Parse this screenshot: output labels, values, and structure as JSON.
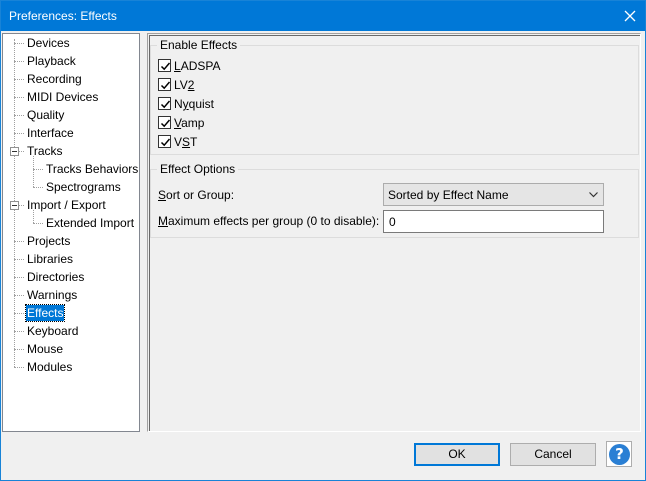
{
  "window": {
    "title": "Preferences: Effects"
  },
  "tree": {
    "items": [
      {
        "label": "Devices",
        "level": 0
      },
      {
        "label": "Playback",
        "level": 0
      },
      {
        "label": "Recording",
        "level": 0
      },
      {
        "label": "MIDI Devices",
        "level": 0
      },
      {
        "label": "Quality",
        "level": 0
      },
      {
        "label": "Interface",
        "level": 0
      },
      {
        "label": "Tracks",
        "level": 0,
        "expanded": true
      },
      {
        "label": "Tracks Behaviors",
        "level": 1
      },
      {
        "label": "Spectrograms",
        "level": 1
      },
      {
        "label": "Import / Export",
        "level": 0,
        "expanded": true
      },
      {
        "label": "Extended Import",
        "level": 1
      },
      {
        "label": "Projects",
        "level": 0
      },
      {
        "label": "Libraries",
        "level": 0
      },
      {
        "label": "Directories",
        "level": 0
      },
      {
        "label": "Warnings",
        "level": 0
      },
      {
        "label": "Effects",
        "level": 0,
        "selected": true
      },
      {
        "label": "Keyboard",
        "level": 0
      },
      {
        "label": "Mouse",
        "level": 0
      },
      {
        "label": "Modules",
        "level": 0
      }
    ]
  },
  "enable_effects": {
    "title": "Enable Effects",
    "items": [
      {
        "pre": "",
        "ul": "L",
        "post": "ADSPA",
        "checked": true
      },
      {
        "pre": "LV",
        "ul": "2",
        "post": "",
        "checked": true
      },
      {
        "pre": "N",
        "ul": "y",
        "post": "quist",
        "checked": true
      },
      {
        "pre": "",
        "ul": "V",
        "post": "amp",
        "checked": true
      },
      {
        "pre": "V",
        "ul": "S",
        "post": "T",
        "checked": true
      }
    ]
  },
  "effect_options": {
    "title": "Effect Options",
    "sort_label_ul": "S",
    "sort_label_rest": "ort or Group:",
    "sort_value": "Sorted by Effect Name",
    "max_label_ul": "M",
    "max_label_rest": "aximum effects per group (0 to disable):",
    "max_value": "0"
  },
  "buttons": {
    "ok": "OK",
    "cancel": "Cancel",
    "help": "?"
  },
  "colors": {
    "titlebar": "#0078d7",
    "selection": "#0078d7",
    "help": "#2a7fd4"
  }
}
